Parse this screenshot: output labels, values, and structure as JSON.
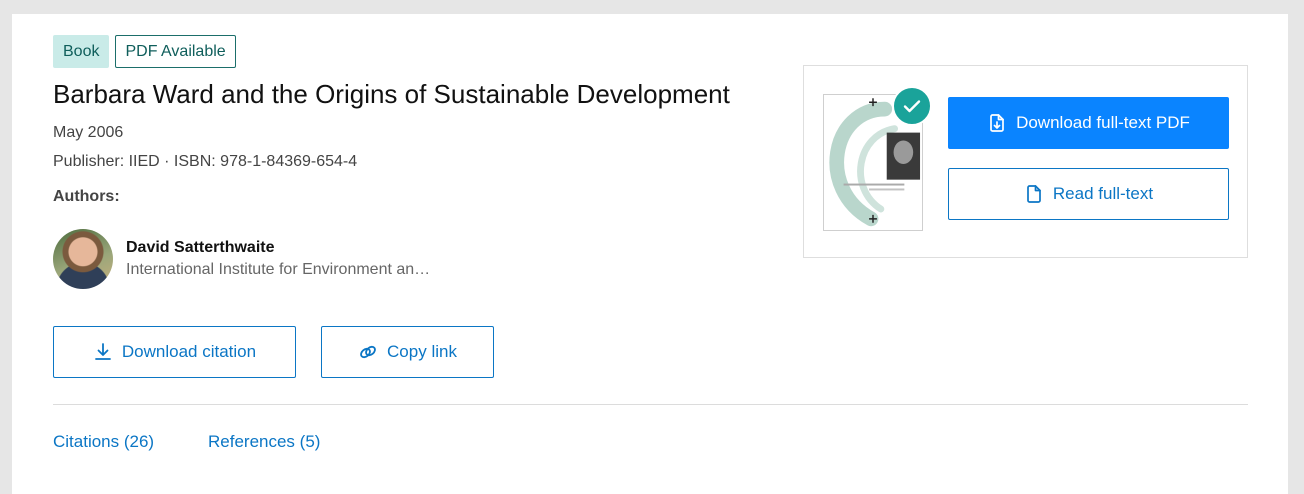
{
  "badges": {
    "type": "Book",
    "availability": "PDF Available"
  },
  "publication": {
    "title": "Barbara Ward and the Origins of Sustainable Development",
    "date": "May 2006",
    "publisher_line": "Publisher: IIED · ISBN: 978-1-84369-654-4"
  },
  "authors": {
    "label": "Authors:",
    "items": [
      {
        "name": "David Satterthwaite",
        "affiliation": "International Institute for Environment an…"
      }
    ]
  },
  "actions": {
    "download_citation": "Download citation",
    "copy_link": "Copy link"
  },
  "fulltext": {
    "download_pdf": "Download full-text PDF",
    "read": "Read full-text"
  },
  "tabs": {
    "citations": "Citations (26)",
    "references": "References (5)"
  },
  "icons": {
    "download_citation": "download-icon",
    "copy_link": "link-icon",
    "download_pdf": "file-download-icon",
    "read": "file-icon",
    "check": "check-icon"
  },
  "colors": {
    "accent": "#0b76c5",
    "primary_button": "#0a84ff",
    "badge_bg": "#c9ebe8",
    "badge_text": "#0f5e5b",
    "check": "#1aa39a"
  }
}
